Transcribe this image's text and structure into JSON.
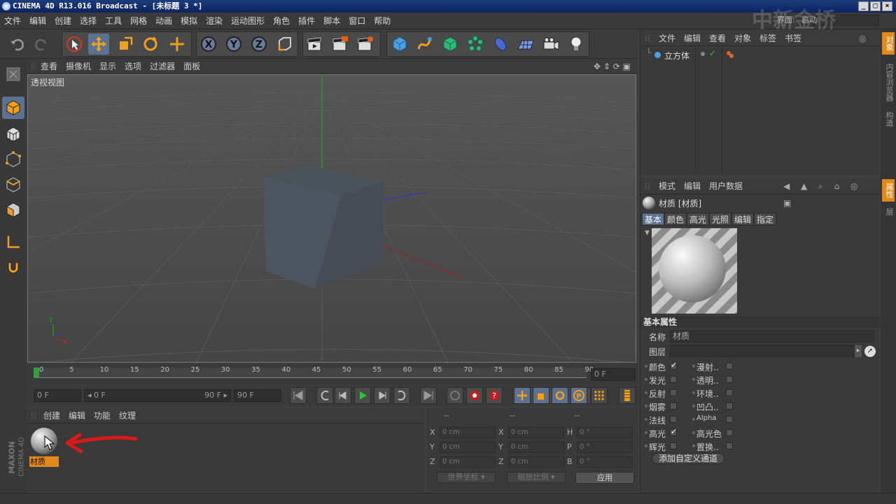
{
  "window": {
    "title": "CINEMA 4D R13.016 Broadcast - [未标题 3 *]",
    "buttons": [
      "_",
      "□",
      "×"
    ]
  },
  "menu": {
    "items": [
      "文件",
      "编辑",
      "创建",
      "选择",
      "工具",
      "网格",
      "动画",
      "模拟",
      "渲染",
      "运动图形",
      "角色",
      "插件",
      "脚本",
      "窗口",
      "帮助"
    ],
    "layout_label": "界面:",
    "layout_value": "启动",
    "watermark": "中新金桥"
  },
  "viewport": {
    "menu": [
      "查看",
      "摄像机",
      "显示",
      "选项",
      "过滤器",
      "面板"
    ],
    "label": "透视视图",
    "axis_y": "Y",
    "axis_x": "X"
  },
  "timeline": {
    "ticks": [
      "0",
      "5",
      "10",
      "15",
      "20",
      "25",
      "30",
      "35",
      "40",
      "45",
      "50",
      "55",
      "60",
      "65",
      "70",
      "75",
      "80",
      "85",
      "90"
    ],
    "current_frame": "0 F",
    "start": "0 F",
    "range_start": "◂ 0 F",
    "range_end": "90 F ▸",
    "end": "90 F"
  },
  "material_manager": {
    "menu": [
      "创建",
      "编辑",
      "功能",
      "纹理"
    ],
    "materials": [
      {
        "name": "材质"
      }
    ],
    "logo_line1": "MAXON",
    "logo_line2": "CINEMA 4D"
  },
  "coordinates": {
    "headers": [
      "--",
      "--",
      "--"
    ],
    "rows": [
      {
        "a": "X",
        "av": "0 cm",
        "b": "X",
        "bv": "0 cm",
        "c": "H",
        "cv": "0 °"
      },
      {
        "a": "Y",
        "av": "0 cm",
        "b": "Y",
        "bv": "0 cm",
        "c": "P",
        "cv": "0 °"
      },
      {
        "a": "Z",
        "av": "0 cm",
        "b": "Z",
        "bv": "0 cm",
        "c": "B",
        "cv": "0 °"
      }
    ],
    "world_coords": "世界坐标",
    "scale_mode": "缩放比例",
    "apply": "应用"
  },
  "object_manager": {
    "menu": [
      "文件",
      "编辑",
      "查看",
      "对象",
      "标签",
      "书签"
    ],
    "objects": [
      {
        "name": "立方体"
      }
    ]
  },
  "attributes": {
    "menu": [
      "模式",
      "编辑",
      "用户数据"
    ],
    "title": "材质 [材质]",
    "tabs": [
      "基本",
      "颜色",
      "高光",
      "光照",
      "编辑",
      "指定"
    ],
    "section": "基本属性",
    "name_label": "名称",
    "name_value": "材质",
    "layer_label": "图层",
    "channels_left": [
      {
        "label": "颜色",
        "checked": true
      },
      {
        "label": "发光",
        "checked": false
      },
      {
        "label": "反射",
        "checked": false
      },
      {
        "label": "烟雾",
        "checked": false
      },
      {
        "label": "法线",
        "checked": false
      },
      {
        "label": "高光",
        "checked": true
      },
      {
        "label": "辉光",
        "checked": false
      }
    ],
    "channels_right": [
      {
        "label": "漫射..",
        "checked": false
      },
      {
        "label": "透明..",
        "checked": false
      },
      {
        "label": "环境..",
        "checked": false
      },
      {
        "label": "凹凸..",
        "checked": false
      },
      {
        "label": "Alpha",
        "checked": false
      },
      {
        "label": "高光色",
        "checked": false
      },
      {
        "label": "置换..",
        "checked": false
      }
    ],
    "add_channel": "添加自定义通道"
  },
  "side_tabs": [
    "对象",
    "内容浏览器",
    "构造",
    "属性",
    "层"
  ],
  "colors": {
    "accent": "#e08a1c",
    "selection": "#5c7290",
    "annotation": "#d81a1a"
  }
}
